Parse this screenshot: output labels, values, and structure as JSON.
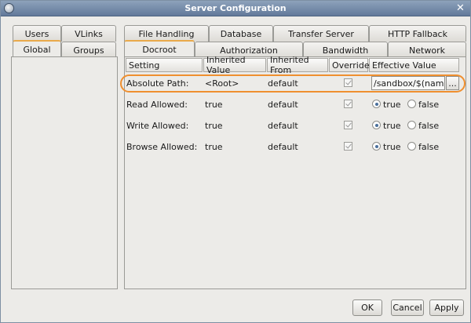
{
  "window": {
    "title": "Server Configuration"
  },
  "left_tabs": {
    "row1": [
      "Users",
      "VLinks"
    ],
    "row2": [
      "Global",
      "Groups"
    ]
  },
  "right_tabs": {
    "row1": [
      "File Handling",
      "Database",
      "Transfer Server",
      "HTTP Fallback"
    ],
    "row2": [
      "Docroot",
      "Authorization",
      "Bandwidth",
      "Network"
    ]
  },
  "table": {
    "columns": [
      "Setting",
      "Inherited Value",
      "Inherited From",
      "Override",
      "Effective Value"
    ],
    "rows": [
      {
        "setting": "Absolute Path:",
        "inherited_value": "<Root>",
        "inherited_from": "default",
        "override": true,
        "effective_value": "/sandbox/$(name)",
        "browse_label": "..."
      },
      {
        "setting": "Read Allowed:",
        "inherited_value": "true",
        "inherited_from": "default",
        "override": true,
        "selected": "true"
      },
      {
        "setting": "Write Allowed:",
        "inherited_value": "true",
        "inherited_from": "default",
        "override": true,
        "selected": "true"
      },
      {
        "setting": "Browse Allowed:",
        "inherited_value": "true",
        "inherited_from": "default",
        "override": true,
        "selected": "true"
      }
    ],
    "radio_labels": {
      "true": "true",
      "false": "false"
    }
  },
  "buttons": {
    "ok": "OK",
    "cancel": "Cancel",
    "apply": "Apply"
  },
  "colors": {
    "highlight": "#ef8f2f",
    "active_tab_accent": "#e9a94a",
    "titlebar": "#6f86a6"
  }
}
